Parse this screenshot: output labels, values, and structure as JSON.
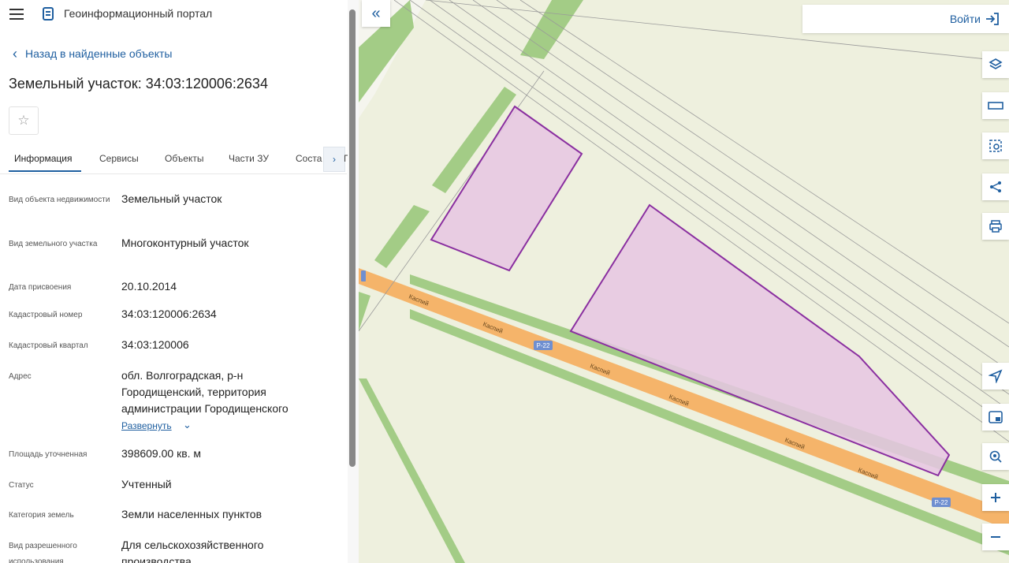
{
  "header": {
    "app_title": "Геоинформационный портал"
  },
  "nav": {
    "back_label": "Назад в найденные объекты"
  },
  "object": {
    "title": "Земельный участок: 34:03:120006:2634"
  },
  "tabs": [
    "Информация",
    "Сервисы",
    "Объекты",
    "Части ЗУ",
    "Соста",
    "П"
  ],
  "active_tab": "Информация",
  "fields": [
    {
      "label": "Вид объекта недвижимости",
      "value": "Земельный участок"
    },
    {
      "label": "Вид земельного участка",
      "value": "Многоконтурный участок"
    },
    {
      "label": "Дата присвоения",
      "value": "20.10.2014"
    },
    {
      "label": "Кадастровый номер",
      "value": "34:03:120006:2634"
    },
    {
      "label": "Кадастровый квартал",
      "value": "34:03:120006"
    },
    {
      "label": "Адрес",
      "value": "обл. Волгоградская, р-н Городищенский, территория администрации Городищенского"
    },
    {
      "label": "Площадь уточненная",
      "value": "398609.00 кв. м"
    },
    {
      "label": "Статус",
      "value": "Учтенный"
    },
    {
      "label": "Категория земель",
      "value": "Земли населенных пунктов"
    },
    {
      "label": "Вид разрешенного использования",
      "value": "Для сельскохозяйственного производства"
    }
  ],
  "expand_label": "Развернуть",
  "map": {
    "login_label": "Войти",
    "road_shield": "Р-22",
    "road_label": "Каспий",
    "colors": {
      "parcel_fill": "#e6c5e3",
      "parcel_stroke": "#8a2fa0",
      "road": "#f5b46a",
      "green": "#a3cc86",
      "land": "#eef0de"
    }
  },
  "icons": {
    "collapse": "double-chevron-left-icon",
    "login": "login-icon",
    "tools": [
      "layers-icon",
      "ruler-icon",
      "select-area-icon",
      "share-icon",
      "print-icon",
      "locate-icon",
      "minimap-icon",
      "search-location-icon",
      "zoom-in-icon",
      "zoom-out-icon"
    ]
  }
}
